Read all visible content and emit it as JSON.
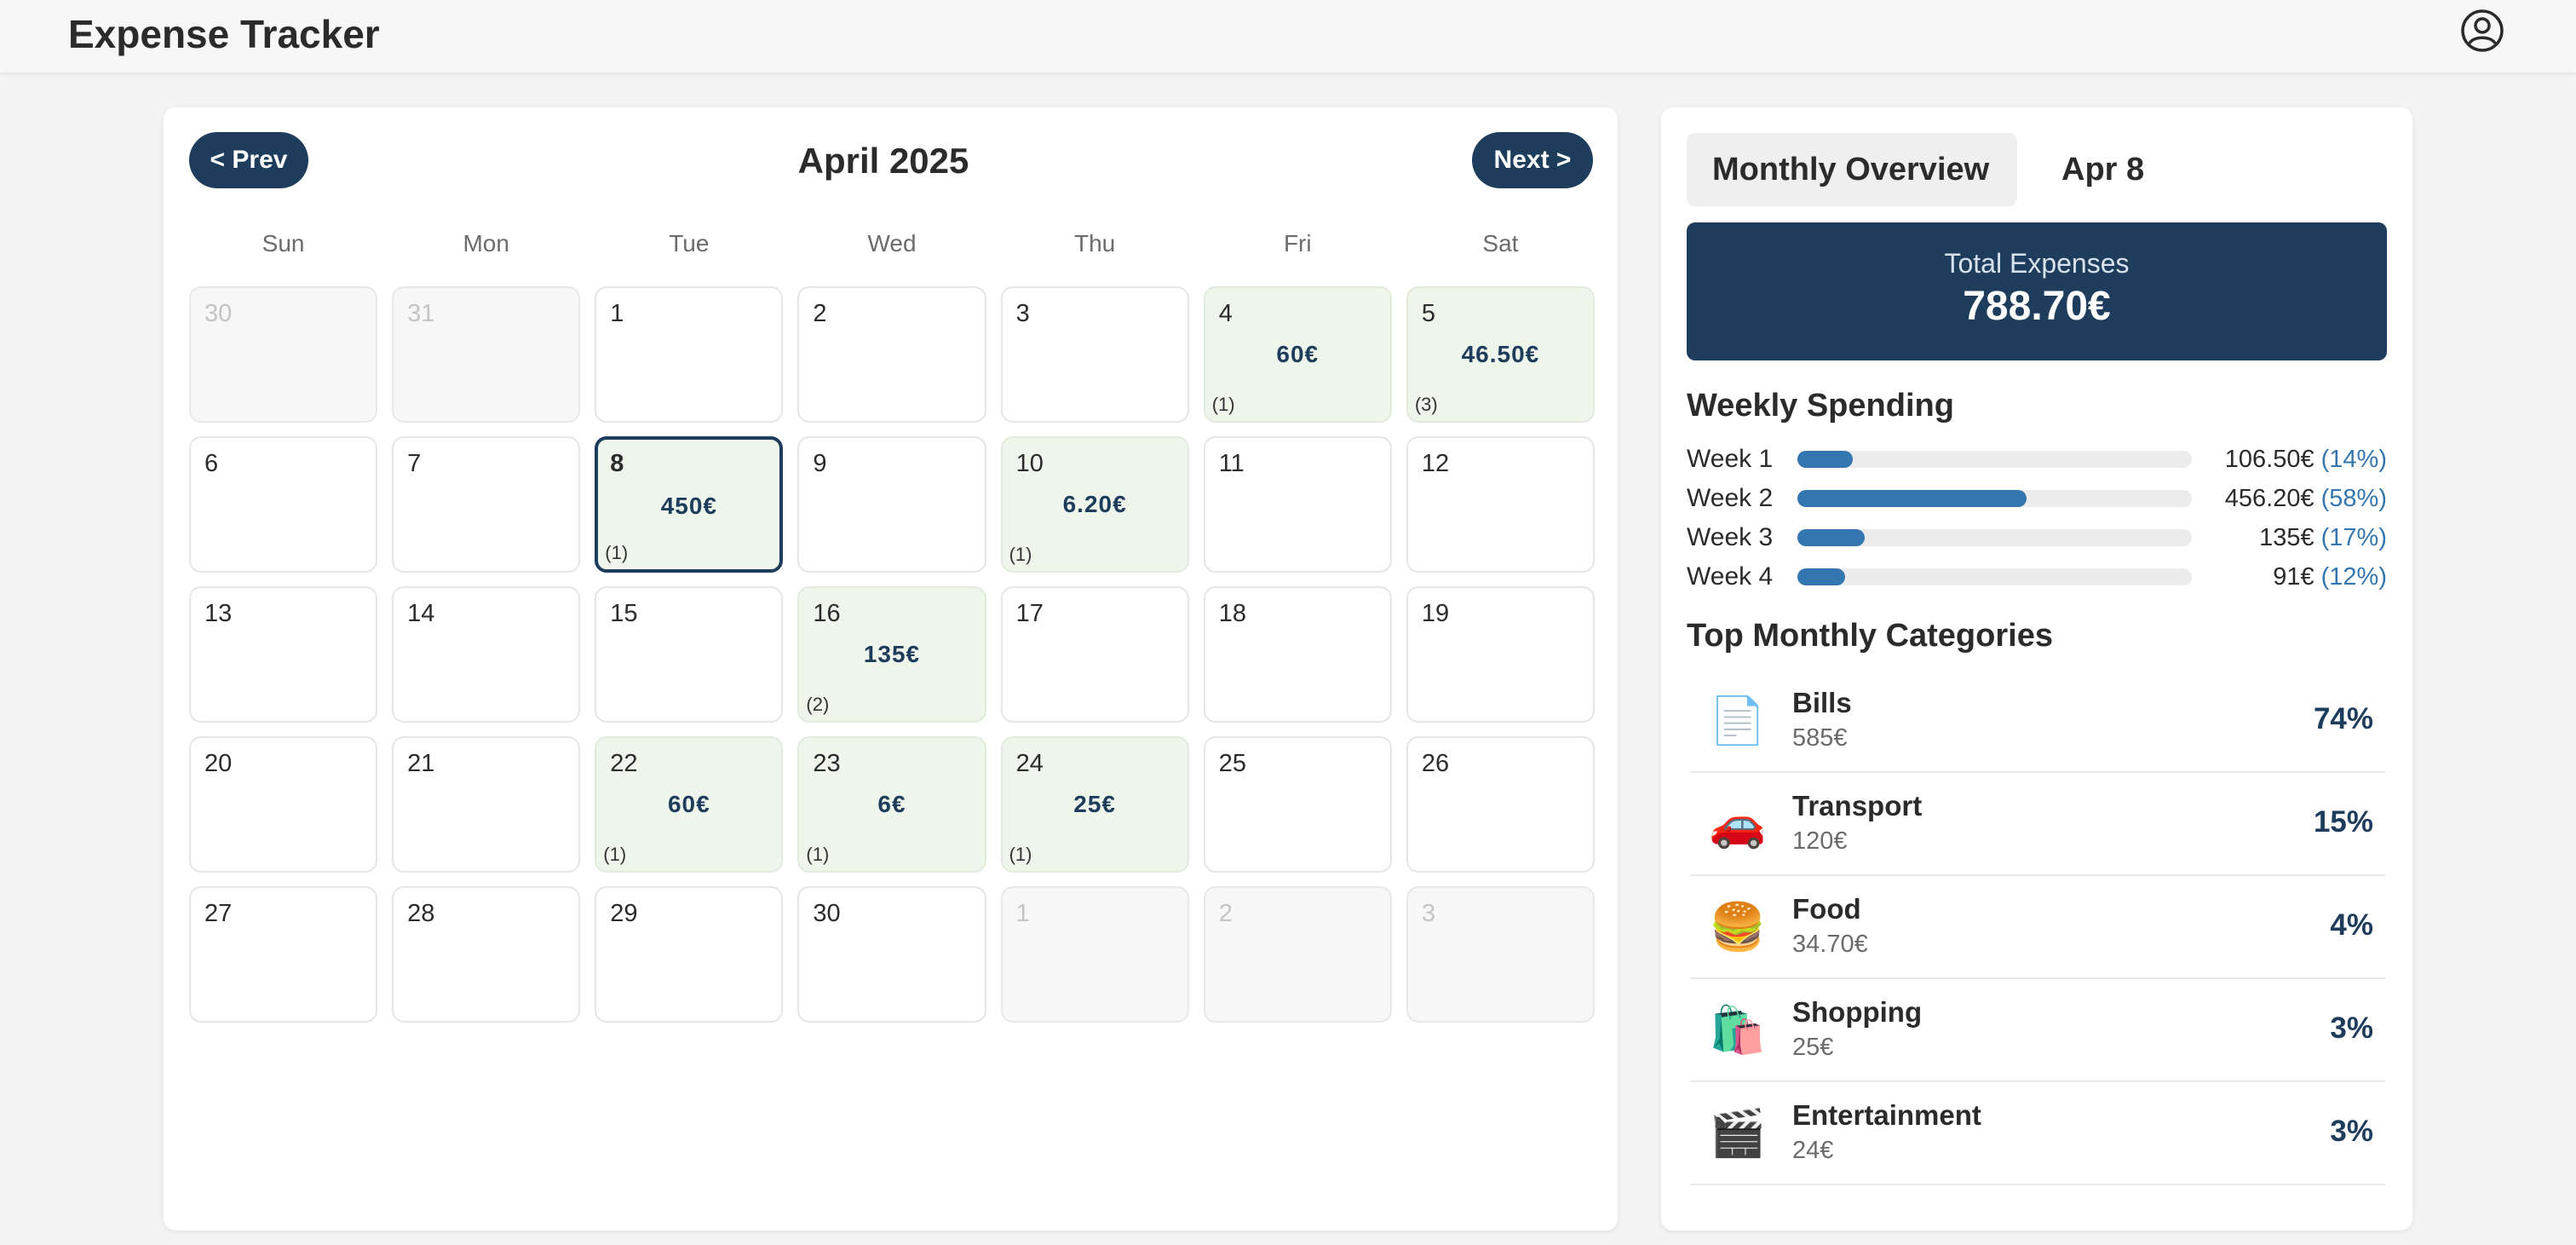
{
  "app": {
    "title": "Expense Tracker",
    "profile_icon": "user-circle-icon"
  },
  "calendar": {
    "prev_label": "< Prev",
    "next_label": "Next >",
    "month_title": "April 2025",
    "weekdays": [
      "Sun",
      "Mon",
      "Tue",
      "Wed",
      "Thu",
      "Fri",
      "Sat"
    ],
    "days": [
      {
        "num": "30",
        "out": true
      },
      {
        "num": "31",
        "out": true
      },
      {
        "num": "1"
      },
      {
        "num": "2"
      },
      {
        "num": "3"
      },
      {
        "num": "4",
        "amount": "60€",
        "count": "(1)"
      },
      {
        "num": "5",
        "amount": "46.50€",
        "count": "(3)"
      },
      {
        "num": "6"
      },
      {
        "num": "7"
      },
      {
        "num": "8",
        "amount": "450€",
        "count": "(1)",
        "selected": true
      },
      {
        "num": "9"
      },
      {
        "num": "10",
        "amount": "6.20€",
        "count": "(1)"
      },
      {
        "num": "11"
      },
      {
        "num": "12"
      },
      {
        "num": "13"
      },
      {
        "num": "14"
      },
      {
        "num": "15"
      },
      {
        "num": "16",
        "amount": "135€",
        "count": "(2)"
      },
      {
        "num": "17"
      },
      {
        "num": "18"
      },
      {
        "num": "19"
      },
      {
        "num": "20"
      },
      {
        "num": "21"
      },
      {
        "num": "22",
        "amount": "60€",
        "count": "(1)"
      },
      {
        "num": "23",
        "amount": "6€",
        "count": "(1)"
      },
      {
        "num": "24",
        "amount": "25€",
        "count": "(1)"
      },
      {
        "num": "25"
      },
      {
        "num": "26"
      },
      {
        "num": "27"
      },
      {
        "num": "28"
      },
      {
        "num": "29"
      },
      {
        "num": "30"
      },
      {
        "num": "1",
        "out": true
      },
      {
        "num": "2",
        "out": true
      },
      {
        "num": "3",
        "out": true
      }
    ]
  },
  "overview": {
    "tabs": [
      {
        "label": "Monthly Overview"
      },
      {
        "label": "Apr 8"
      }
    ],
    "total_label": "Total Expenses",
    "total_value": "788.70€",
    "weekly_title": "Weekly Spending",
    "weeks": [
      {
        "label": "Week 1",
        "amount": "106.50€",
        "pct": "(14%)",
        "fill_pct": 14
      },
      {
        "label": "Week 2",
        "amount": "456.20€",
        "pct": "(58%)",
        "fill_pct": 58
      },
      {
        "label": "Week 3",
        "amount": "135€",
        "pct": "(17%)",
        "fill_pct": 17
      },
      {
        "label": "Week 4",
        "amount": "91€",
        "pct": "(12%)",
        "fill_pct": 12
      }
    ],
    "categories_title": "Top Monthly Categories",
    "categories": [
      {
        "icon": "📄",
        "icon_name": "document-icon",
        "name": "Bills",
        "amount": "585€",
        "pct": "74%"
      },
      {
        "icon": "🚗",
        "icon_name": "car-icon",
        "name": "Transport",
        "amount": "120€",
        "pct": "15%"
      },
      {
        "icon": "🍔",
        "icon_name": "burger-icon",
        "name": "Food",
        "amount": "34.70€",
        "pct": "4%"
      },
      {
        "icon": "🛍️",
        "icon_name": "shopping-bags-icon",
        "name": "Shopping",
        "amount": "25€",
        "pct": "3%"
      },
      {
        "icon": "🎬",
        "icon_name": "clapperboard-icon",
        "name": "Entertainment",
        "amount": "24€",
        "pct": "3%"
      }
    ]
  },
  "colors": {
    "primary": "#1e3d5c",
    "accent": "#3477b0",
    "has_expense_bg": "#eef6ec"
  }
}
